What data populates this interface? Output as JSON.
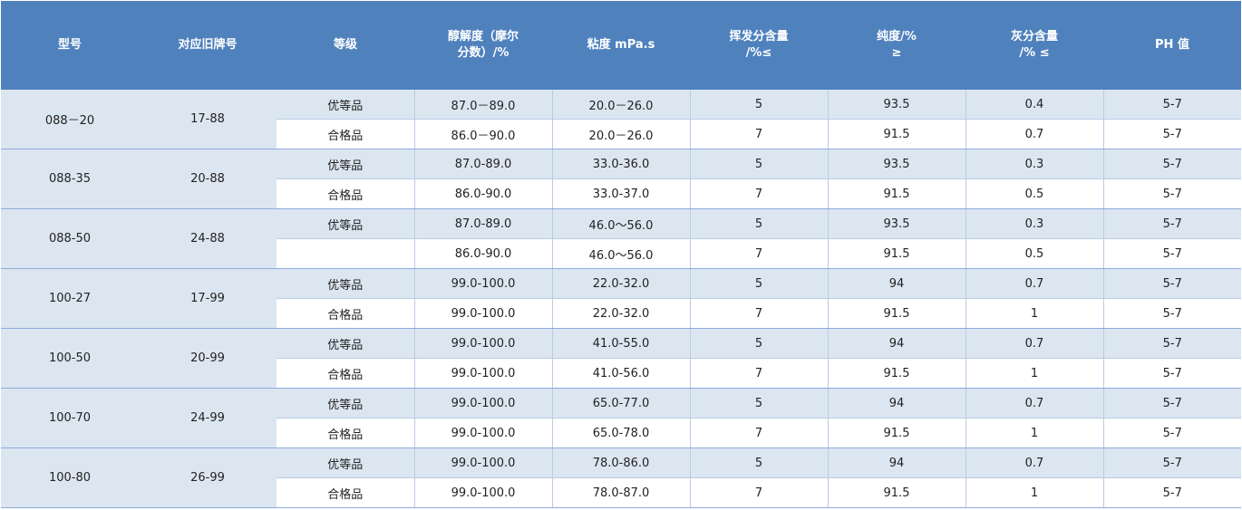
{
  "headers": [
    "型号",
    "对应旧牌号",
    "等级",
    "醇解度（摩尔\n分数）/%",
    "粘度 mPa.s",
    "挥发分含量\n/%≤",
    "纯度/%\n≥",
    "灰分含量\n/% ≤",
    "PH 值"
  ],
  "groups": [
    {
      "model": "088－20",
      "old_grade": "17-88",
      "rows": [
        {
          "grade": "优等品",
          "alcoholysis": "87.0－89.0",
          "viscosity": "20.0－26.0",
          "volatile": "5",
          "purity": "93.5",
          "ash": "0.4",
          "ph": "5-7"
        },
        {
          "grade": "合格品",
          "alcoholysis": "86.0－90.0",
          "viscosity": "20.0－26.0",
          "volatile": "7",
          "purity": "91.5",
          "ash": "0.7",
          "ph": "5-7"
        }
      ]
    },
    {
      "model": "088-35",
      "old_grade": "20-88",
      "rows": [
        {
          "grade": "优等品",
          "alcoholysis": "87.0-89.0",
          "viscosity": "33.0-36.0",
          "volatile": "5",
          "purity": "93.5",
          "ash": "0.3",
          "ph": "5-7"
        },
        {
          "grade": "合格品",
          "alcoholysis": "86.0-90.0",
          "viscosity": "33.0-37.0",
          "volatile": "7",
          "purity": "91.5",
          "ash": "0.5",
          "ph": "5-7"
        }
      ]
    },
    {
      "model": "088-50",
      "old_grade": "24-88",
      "rows": [
        {
          "grade": "优等品",
          "alcoholysis": "87.0-89.0",
          "viscosity": "46.0～56.0",
          "volatile": "5",
          "purity": "93.5",
          "ash": "0.3",
          "ph": "5-7"
        },
        {
          "grade": "",
          "alcoholysis": "86.0-90.0",
          "viscosity": "46.0～56.0",
          "volatile": "7",
          "purity": "91.5",
          "ash": "0.5",
          "ph": "5-7"
        }
      ]
    },
    {
      "model": "100-27",
      "old_grade": "17-99",
      "rows": [
        {
          "grade": "优等品",
          "alcoholysis": "99.0-100.0",
          "viscosity": "22.0-32.0",
          "volatile": "5",
          "purity": "94",
          "ash": "0.7",
          "ph": "5-7"
        },
        {
          "grade": "合格品",
          "alcoholysis": "99.0-100.0",
          "viscosity": "22.0-32.0",
          "volatile": "7",
          "purity": "91.5",
          "ash": "1",
          "ph": "5-7"
        }
      ]
    },
    {
      "model": "100-50",
      "old_grade": "20-99",
      "rows": [
        {
          "grade": "优等品",
          "alcoholysis": "99.0-100.0",
          "viscosity": "41.0-55.0",
          "volatile": "5",
          "purity": "94",
          "ash": "0.7",
          "ph": "5-7"
        },
        {
          "grade": "合格品",
          "alcoholysis": "99.0-100.0",
          "viscosity": "41.0-56.0",
          "volatile": "7",
          "purity": "91.5",
          "ash": "1",
          "ph": "5-7"
        }
      ]
    },
    {
      "model": "100-70",
      "old_grade": "24-99",
      "rows": [
        {
          "grade": "优等品",
          "alcoholysis": "99.0-100.0",
          "viscosity": "65.0-77.0",
          "volatile": "5",
          "purity": "94",
          "ash": "0.7",
          "ph": "5-7"
        },
        {
          "grade": "合格品",
          "alcoholysis": "99.0-100.0",
          "viscosity": "65.0-78.0",
          "volatile": "7",
          "purity": "91.5",
          "ash": "1",
          "ph": "5-7"
        }
      ]
    },
    {
      "model": "100-80",
      "old_grade": "26-99",
      "rows": [
        {
          "grade": "优等品",
          "alcoholysis": "99.0-100.0",
          "viscosity": "78.0-86.0",
          "volatile": "5",
          "purity": "94",
          "ash": "0.7",
          "ph": "5-7"
        },
        {
          "grade": "合格品",
          "alcoholysis": "99.0-100.0",
          "viscosity": "78.0-87.0",
          "volatile": "7",
          "purity": "91.5",
          "ash": "1",
          "ph": "5-7"
        }
      ]
    }
  ],
  "colors": {
    "header_bg": "#4f81bd",
    "header_text": "#ffffff",
    "band_bg": "#dce6f1",
    "grid": "#b8cce4"
  }
}
